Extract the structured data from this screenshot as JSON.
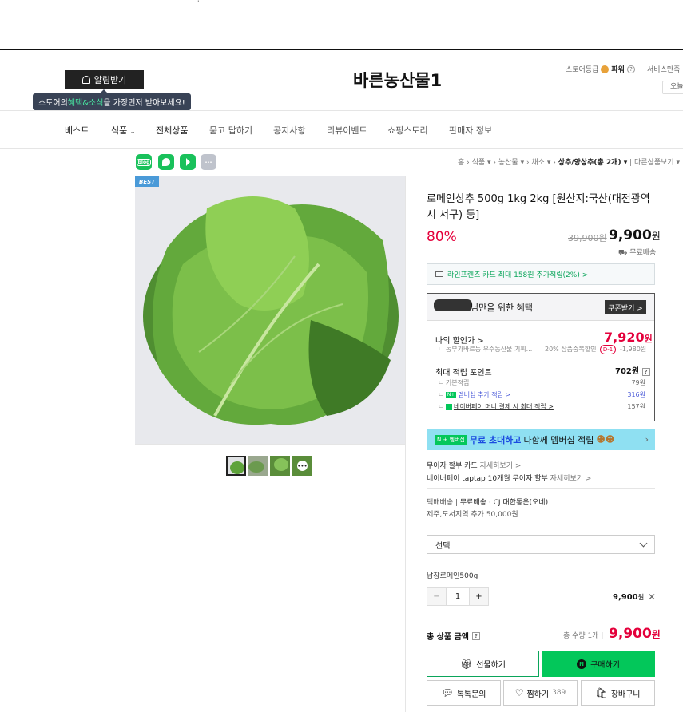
{
  "header": {
    "top_mark": "'",
    "alarm_label": "알림받기",
    "tooltip_pre": "스토어의 ",
    "tooltip_hl": "혜택&소식",
    "tooltip_post": "을 가장먼저 받아보세요!",
    "store_title": "바른농산물1",
    "grade_label": "스토어등급",
    "grade_value": "파워",
    "service_label": "서비스만족",
    "today_label": "오늘"
  },
  "nav": [
    "베스트",
    "식품",
    "전체상품",
    "묻고 답하기",
    "공지사항",
    "리뷰이벤트",
    "쇼핑스토리",
    "판매자 정보"
  ],
  "share": {
    "blog": "blog",
    "more": "···"
  },
  "breadcrumb": {
    "home": "홈",
    "c1": "식품",
    "c2": "농산물",
    "c3": "채소",
    "current": "상추/양상추",
    "current_count": "(총 2개)",
    "other": "다른상품보기"
  },
  "product": {
    "badge": "BEST",
    "title": "로메인상추 500g 1kg 2kg [원산지:국산(대전광역시 서구) 등]",
    "discount": "80%",
    "original_price": "39,900원",
    "price": "9,900",
    "won": "원",
    "free_ship": "무료배송"
  },
  "card_promo": "라인프렌즈 카드 최대 158원 추가적립(2%) >",
  "benefit": {
    "title": "님만을 위한 혜택",
    "coupon_btn": "쿠폰받기 >",
    "my_discount_label": "나의 할인가 >",
    "my_discount_value": "7,920",
    "won": "원",
    "sub_desc": "ㄴ 농부가바르농 우수농산물 기획...",
    "sub_pct": "20% 상품중복할인",
    "sub_tag": "D-1",
    "sub_amount": "-1,980원",
    "points_label": "최대 적립 포인트",
    "points_value": "702원",
    "q": "?",
    "rows": [
      {
        "label": "ㄴ 기본적립",
        "value": "79원"
      },
      {
        "label": "멤버십 추가 적립 >",
        "value": "316원"
      },
      {
        "label": "네이버페이 머니 결제 시 최대 적립 >",
        "value": "157원"
      }
    ]
  },
  "membership_banner": {
    "tag": "N + 멤버십",
    "b1": "무료 초대하고",
    "b2": " 다함께 멤버십 적립",
    "arrow": "›"
  },
  "payment": {
    "installment_label": "무이자 할부 카드",
    "installment_link": "자세히보기 >",
    "npay_label": "네이버페이 taptap 10개월 무이자 할부",
    "npay_link": "자세히보기 >"
  },
  "shipping": {
    "line1_label": "택배배송",
    "line1_value": "무료배송 · CJ 대한통운(오네)",
    "line2": "제주,도서지역 추가 50,000원"
  },
  "order": {
    "select_placeholder": "선택",
    "option_name": "남장로메인500g",
    "minus": "−",
    "qty": "1",
    "plus": "+",
    "option_price": "9,900",
    "won": "원",
    "remove": "✕",
    "total_label": "총 상품 금액",
    "total_q": "?",
    "total_qty": "총 수량 1개",
    "total_price": "9,900",
    "gift_btn": "선물하기",
    "buy_btn": "구매하기",
    "talk_btn": "톡톡문의",
    "wish_btn": "찜하기",
    "wish_count": "389",
    "cart_btn": "장바구니"
  },
  "colors": {
    "accent_red": "#e4003b",
    "naver_green": "#03c75a",
    "banner_blue": "#8fe0f2"
  }
}
